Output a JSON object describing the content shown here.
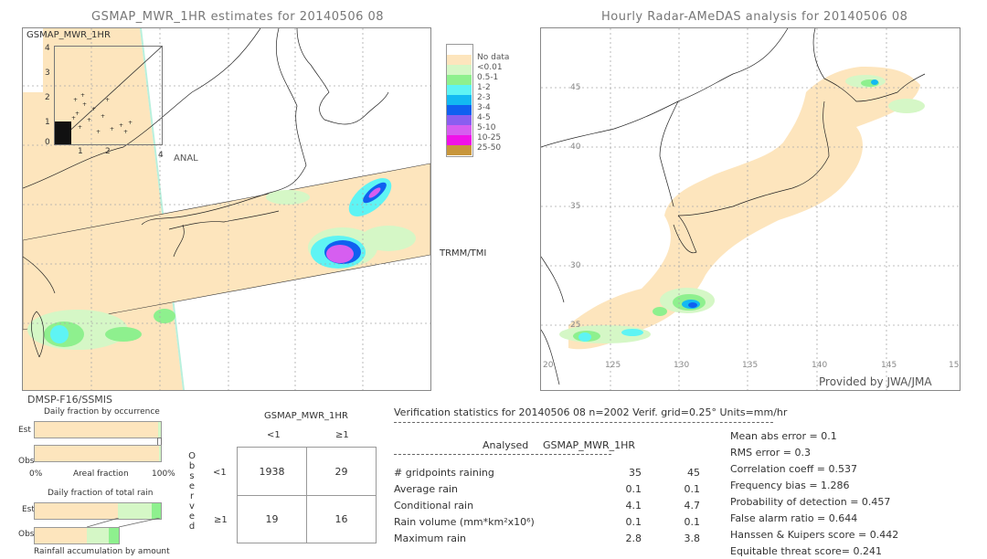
{
  "left_map": {
    "title": "GSMAP_MWR_1HR estimates for 20140506 08",
    "inset_label": "GSMAP_MWR_1HR",
    "inset_x_label": "ANAL",
    "inset_y_ticks": [
      "4",
      "3",
      "2",
      "1",
      "0"
    ],
    "inset_x_ticks": [
      "1",
      "2",
      "4"
    ],
    "swath_label": "TRMM/TMI",
    "sensor_label": "DMSP-F16/SSMIS"
  },
  "right_map": {
    "title": "Hourly Radar-AMeDAS analysis for 20140506 08",
    "lat_ticks": [
      "45",
      "40",
      "35",
      "30",
      "25",
      "20"
    ],
    "lon_ticks": [
      "125",
      "130",
      "135",
      "140",
      "145",
      "15"
    ],
    "credit": "Provided by JWA/JMA"
  },
  "legend": {
    "items": [
      {
        "label": "",
        "color": "#ffffff"
      },
      {
        "label": "No data",
        "color": "#fde5bd"
      },
      {
        "label": "<0.01",
        "color": "#d5f7c6"
      },
      {
        "label": "0.5-1",
        "color": "#8ef08e"
      },
      {
        "label": "1-2",
        "color": "#5ef4f4"
      },
      {
        "label": "2-3",
        "color": "#13b9f2"
      },
      {
        "label": "3-4",
        "color": "#1060f0"
      },
      {
        "label": "4-5",
        "color": "#8a5ef0"
      },
      {
        "label": "5-10",
        "color": "#d65ef0"
      },
      {
        "label": "10-25",
        "color": "#f012e8"
      },
      {
        "label": "25-50",
        "color": "#c8963c"
      }
    ]
  },
  "occurrence": {
    "title": "Daily fraction by occurrence",
    "est_label": "Est",
    "obs_label": "Obs",
    "axis_left": "0%",
    "axis_mid": "Areal fraction",
    "axis_right": "100%",
    "est_fractions": [
      {
        "value": 0.977,
        "color": "#fde5bd"
      },
      {
        "value": 0.023,
        "color": "#d5f7c6"
      }
    ],
    "obs_fractions": [
      {
        "value": 0.983,
        "color": "#fde5bd"
      },
      {
        "value": 0.017,
        "color": "#d5f7c6"
      }
    ]
  },
  "total_rain": {
    "title": "Daily fraction of total rain",
    "est_label": "Est",
    "obs_label": "Obs",
    "footer": "Rainfall accumulation by amount",
    "est_fractions": [
      {
        "value": 0.66,
        "color": "#fde5bd"
      },
      {
        "value": 0.27,
        "color": "#d5f7c6"
      },
      {
        "value": 0.07,
        "color": "#8ef08e"
      }
    ],
    "obs_fractions": [
      {
        "value": 0.62,
        "color": "#fde5bd"
      },
      {
        "value": 0.26,
        "color": "#d5f7c6"
      },
      {
        "value": 0.12,
        "color": "#8ef08e"
      }
    ]
  },
  "contingency": {
    "title": "GSMAP_MWR_1HR",
    "col_headers": [
      "<1",
      "≥1"
    ],
    "row_headers": [
      "<1",
      "≥1"
    ],
    "side_label": "Observed",
    "cells": [
      [
        "1938",
        "29"
      ],
      [
        "19",
        "16"
      ]
    ]
  },
  "stats": {
    "header": "Verification statistics for 20140506 08   n=2002   Verif. grid=0.25°   Units=mm/hr",
    "col_analysed": "Analysed",
    "col_estimate": "GSMAP_MWR_1HR",
    "rows": [
      {
        "label": "# gridpoints raining",
        "analysed": "35",
        "estimate": "45"
      },
      {
        "label": "Average rain",
        "analysed": "0.1",
        "estimate": "0.1"
      },
      {
        "label": "Conditional rain",
        "analysed": "4.1",
        "estimate": "4.7"
      },
      {
        "label": "Rain volume (mm*km²x10⁶)",
        "analysed": "0.1",
        "estimate": "0.1"
      },
      {
        "label": "Maximum rain",
        "analysed": "2.8",
        "estimate": "3.8"
      }
    ],
    "scores": [
      "Mean abs error = 0.1",
      "RMS error = 0.3",
      "Correlation coeff = 0.537",
      "Frequency bias = 1.286",
      "Probability of detection = 0.457",
      "False alarm ratio = 0.644",
      "Hanssen & Kuipers score = 0.442",
      "Equitable threat score= 0.241"
    ]
  }
}
